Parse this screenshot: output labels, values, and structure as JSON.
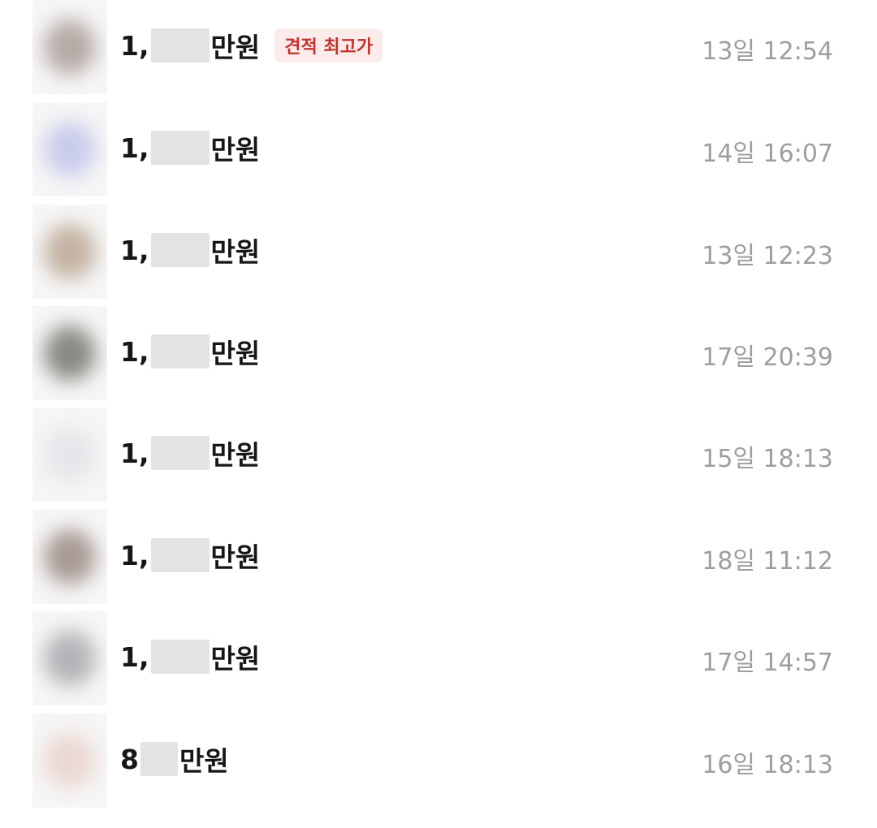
{
  "rows": [
    {
      "prefix": "1,",
      "unit": "만원",
      "badge": "견적 최고가",
      "time": "13일 12:54",
      "thumb_color": "#b6aaa6"
    },
    {
      "prefix": "1,",
      "unit": "만원",
      "badge": "",
      "time": "14일 16:07",
      "thumb_color": "#c9ccec"
    },
    {
      "prefix": "1,",
      "unit": "만원",
      "badge": "",
      "time": "13일 12:23",
      "thumb_color": "#c4b2a2"
    },
    {
      "prefix": "1,",
      "unit": "만원",
      "badge": "",
      "time": "17일 20:39",
      "thumb_color": "#8a8a84"
    },
    {
      "prefix": "1,",
      "unit": "만원",
      "badge": "",
      "time": "15일 18:13",
      "thumb_color": "#e6e6ea"
    },
    {
      "prefix": "1,",
      "unit": "만원",
      "badge": "",
      "time": "18일 11:12",
      "thumb_color": "#a89a94"
    },
    {
      "prefix": "1,",
      "unit": "만원",
      "badge": "",
      "time": "17일 14:57",
      "thumb_color": "#b4b4b8"
    },
    {
      "prefix": "8",
      "unit": "만원",
      "badge": "",
      "time": "16일 18:13",
      "thumb_color": "#ead8d2"
    }
  ]
}
